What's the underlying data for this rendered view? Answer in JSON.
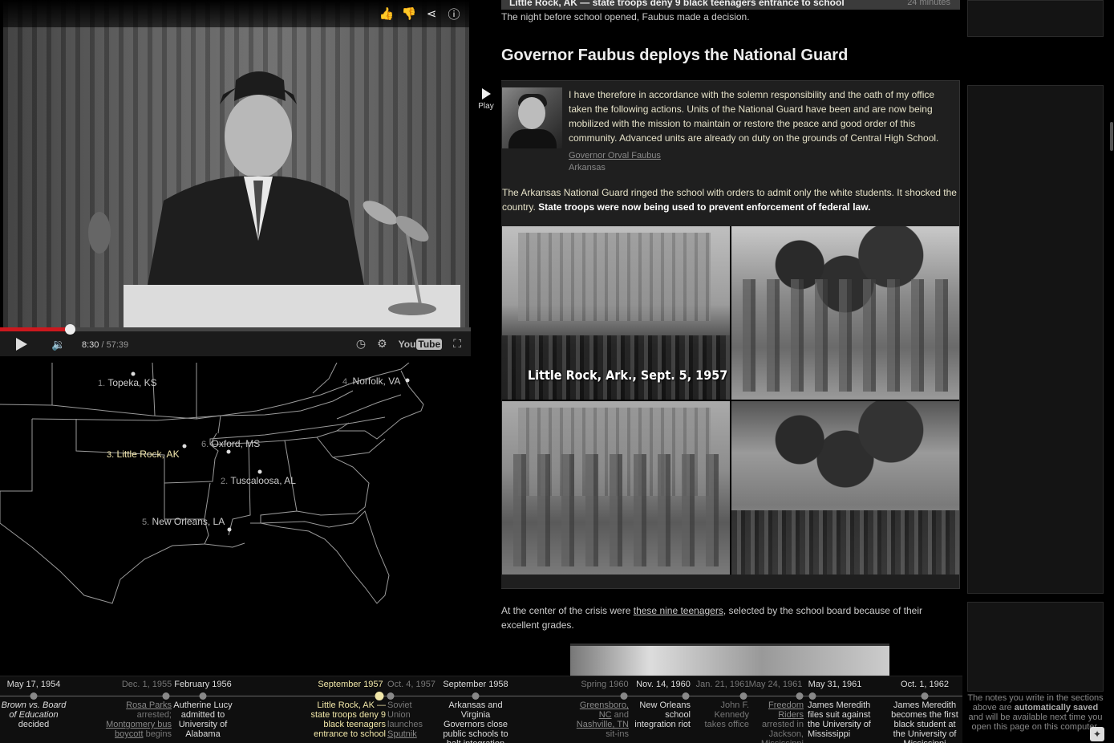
{
  "video": {
    "time_current": "8:30",
    "time_total": "/ 57:39",
    "progress": 0.148,
    "icons": [
      "like-icon",
      "dislike-icon",
      "share-icon",
      "info-icon"
    ],
    "youtube_label": "You",
    "youtube_tube": "Tube"
  },
  "map": {
    "cities": [
      {
        "num": "1.",
        "name": "Topeka, KS"
      },
      {
        "num": "2.",
        "name": "Tuscaloosa, AL"
      },
      {
        "num": "3.",
        "name": "Little Rock, AK"
      },
      {
        "num": "4.",
        "name": "Norfolk, VA"
      },
      {
        "num": "5.",
        "name": "New Orleans, LA"
      },
      {
        "num": "6.",
        "name": "Oxford, MS"
      }
    ]
  },
  "content": {
    "prev_section_title": "Little Rock, AK — state troops deny 9 black teenagers entrance to school",
    "prev_section_duration": "24 minutes",
    "intro": "The night before school opened, Faubus made a decision.",
    "heading": "Governor Faubus deploys the National Guard",
    "play_label": "Play",
    "quote": "I have therefore in accordance with the solemn responsibility and the oath of my office taken the following actions. Units of the National Guard have been and are now being mobilized with the mission to maintain or restore the peace and good order of this community. Advanced units are already on duty on the grounds of Central High School.",
    "speaker_name": "Governor Orval Faubus",
    "speaker_location": "Arkansas",
    "para_text": "The Arkansas National Guard ringed the school with orders to admit only the white students. It shocked the country. ",
    "para_bold": "State troops were now being used to prevent enforcement of federal law.",
    "photo_caption": "Little Rock, Ark., Sept. 5, 1957",
    "outro_before": "At the center of the crisis were ",
    "outro_link": "these nine teenagers",
    "outro_after": ", selected by the school board because of their excellent grades."
  },
  "sidebar": {
    "note_before": "The notes you write in the sections above are ",
    "note_bold1": "automatically saved",
    "note_after": " and will be available next time you open this page on this computer."
  },
  "timeline": [
    {
      "date": "May 17, 1954",
      "desc_italic": "Brown vs. Board of Education",
      "desc": " decided",
      "state": "normal"
    },
    {
      "date": "Dec. 1, 1955",
      "desc_link": "Rosa Parks",
      "desc": " arrested; ",
      "desc_link2": "Montgomery bus boycott",
      "desc_end": " begins",
      "state": "dim"
    },
    {
      "date": "February 1956",
      "desc": "Autherine Lucy admitted to University of Alabama",
      "state": "normal"
    },
    {
      "date": "September 1957",
      "desc": "Little Rock, AK — state troops deny 9 black teenagers entrance to school",
      "state": "active"
    },
    {
      "date": "Oct. 4, 1957",
      "desc": "Soviet Union launches ",
      "desc_link": "Sputnik",
      "state": "dim"
    },
    {
      "date": "September 1958",
      "desc": "Arkansas and Virginia Governors close public schools to halt integration",
      "state": "normal"
    },
    {
      "date": "Spring 1960",
      "desc_link": "Greensboro, NC",
      "desc": " and ",
      "desc_link2": "Nashville, TN",
      "desc_end": " sit-ins",
      "state": "dim"
    },
    {
      "date": "Nov. 14, 1960",
      "desc": "New Orleans school integration riot",
      "state": "normal"
    },
    {
      "date": "Jan. 21, 1961",
      "desc": "John F. Kennedy takes office",
      "state": "dim"
    },
    {
      "date": "May 24, 1961",
      "desc_link": "Freedom Riders",
      "desc": " arrested in Jackson, Mississippi",
      "state": "dim"
    },
    {
      "date": "May 31, 1961",
      "desc": "James Meredith files suit against the University of Mississippi",
      "state": "normal"
    },
    {
      "date": "Oct. 1, 1962",
      "desc": "James Meredith becomes the first black student at the University of Mississippi",
      "state": "normal"
    }
  ]
}
